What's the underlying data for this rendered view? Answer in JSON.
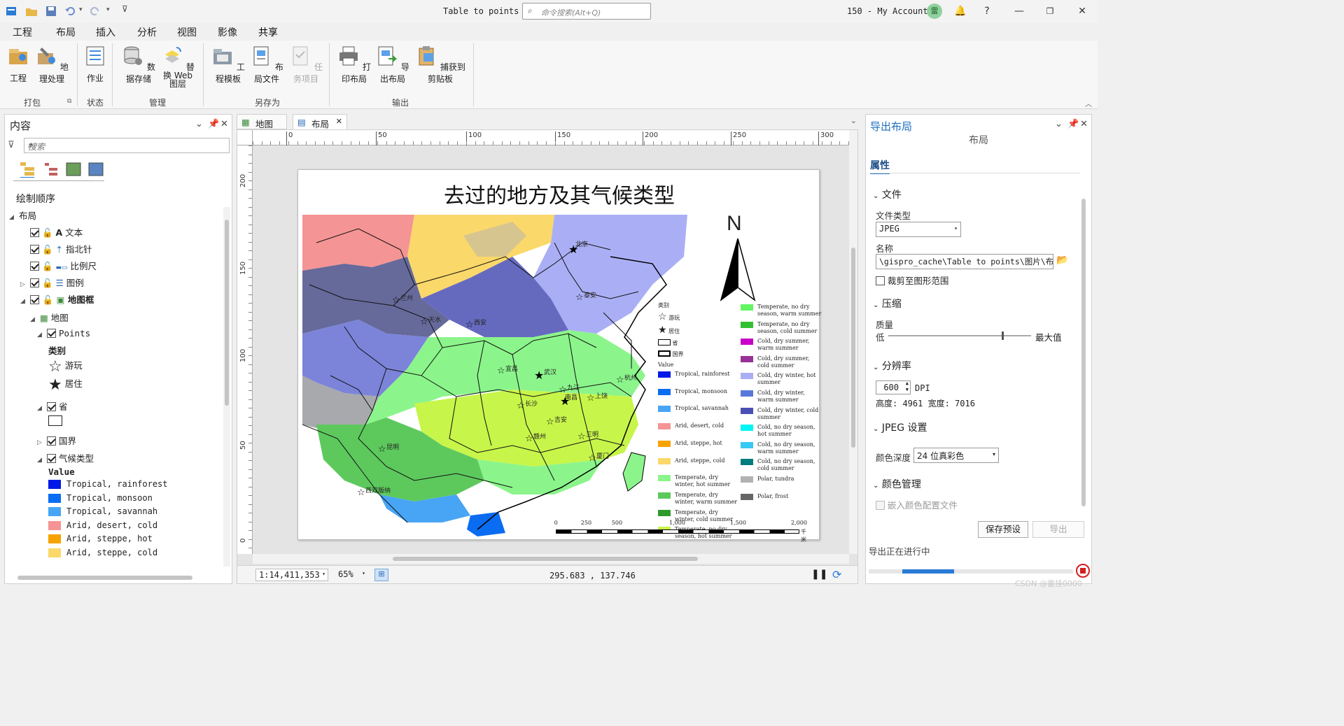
{
  "titlebar": {
    "title": "Table to points",
    "search_placeholder": "命令搜索(Alt+Q)",
    "account": "150 - My Account",
    "avatar_text": "雷"
  },
  "ribbon": {
    "tabs": [
      "工程",
      "布局",
      "插入",
      "分析",
      "视图",
      "影像",
      "共享"
    ],
    "active_tab": "共享",
    "buttons": {
      "project": "工程",
      "geoprocessing": "地理处理",
      "job": "作业",
      "data_store": "数据存储",
      "replace_web_1": "替换 Web",
      "replace_web_2": "图层",
      "project_template": "工程模板",
      "layout_file": "布局文件",
      "task_item": "任务项目",
      "print_layout": "打印布局",
      "export_layout": "导出布局",
      "capture_clipboard": "捕获到剪贴板"
    },
    "groups": {
      "package": "打包",
      "status": "状态",
      "manage": "管理",
      "save_as": "另存为",
      "output": "输出"
    }
  },
  "contents": {
    "title": "内容",
    "search_placeholder": "搜索",
    "drawing_order": "绘制顺序",
    "layout": "布局",
    "text": "文本",
    "north_arrow": "指北针",
    "scale_bar": "比例尺",
    "legend": "图例",
    "map_frame": "地图框",
    "map": "地图",
    "points": "Points",
    "category": "类别",
    "visited": "游玩",
    "lived": "居住",
    "province": "省",
    "border": "国界",
    "climate": "气候类型",
    "value_header": "Value",
    "legend_items": [
      {
        "label": "Tropical, rainforest",
        "color": "#0019e6"
      },
      {
        "label": "Tropical, monsoon",
        "color": "#0a6cf0"
      },
      {
        "label": "Tropical, savannah",
        "color": "#48a5f5"
      },
      {
        "label": "Arid, desert, cold",
        "color": "#f59494"
      },
      {
        "label": "Arid, steppe, hot",
        "color": "#f5a300"
      },
      {
        "label": "Arid, steppe, cold",
        "color": "#fbd86a"
      }
    ]
  },
  "view": {
    "tab_map": "地图",
    "tab_layout": "布局",
    "hruler_ticks": [
      "0",
      "50",
      "100",
      "150",
      "200",
      "250",
      "300"
    ],
    "vruler_ticks": [
      "200",
      "150",
      "100",
      "50",
      "0"
    ],
    "scale": "1:14,411,353",
    "zoom": "65%",
    "coords": "295.683 , 137.746"
  },
  "map": {
    "title": "去过的地方及其气候类型",
    "north": "N",
    "legend_category_title": "类别",
    "legend_visited": "游玩",
    "legend_lived": "居住",
    "legend_province": "省",
    "legend_border": "国界",
    "legend_value_title": "Value",
    "legend_col1": [
      {
        "label": "Tropical, rainforest",
        "color": "#0019e6"
      },
      {
        "label": "Tropical, monsoon",
        "color": "#0a6cf0"
      },
      {
        "label": "Tropical, savannah",
        "color": "#48a5f5"
      },
      {
        "label": "Arid, desert, cold",
        "color": "#f59494"
      },
      {
        "label": "Arid, steppe, hot",
        "color": "#f5a300"
      },
      {
        "label": "Arid, steppe, cold",
        "color": "#fbd86a"
      },
      {
        "label": "Temperate, dry winter, hot summer",
        "color": "#8bf58b"
      },
      {
        "label": "Temperate, dry winter, warm summer",
        "color": "#5dc95d"
      },
      {
        "label": "Temperate, dry winter, cold summer",
        "color": "#2e9a2e"
      },
      {
        "label": "Temperate, no dry season, hot summer",
        "color": "#c8f54a"
      }
    ],
    "legend_col2": [
      {
        "label": "Temperate, no dry season, warm summer",
        "color": "#63f563"
      },
      {
        "label": "Temperate, no dry season, cold summer",
        "color": "#32c032"
      },
      {
        "label": "Cold, dry summer, warm summer",
        "color": "#c800c8"
      },
      {
        "label": "Cold, dry summer, cold summer",
        "color": "#963296"
      },
      {
        "label": "Cold, dry winter, hot summer",
        "color": "#aaaff5"
      },
      {
        "label": "Cold, dry winter, warm summer",
        "color": "#5a78dc"
      },
      {
        "label": "Cold, dry winter, cold summer",
        "color": "#4b50b4"
      },
      {
        "label": "Cold, no dry season, hot summer",
        "color": "#00f5f5"
      },
      {
        "label": "Cold, no dry season, warm summer",
        "color": "#37c8f5"
      },
      {
        "label": "Cold, no dry season, cold summer",
        "color": "#007d7d"
      },
      {
        "label": "Polar, tundra",
        "color": "#b2b2b2"
      },
      {
        "label": "Polar, frost",
        "color": "#666666"
      }
    ],
    "scale_ticks": [
      "0",
      "250",
      "500",
      "1,000",
      "1,500",
      "2,000"
    ],
    "scale_unit": "千米",
    "cities": [
      "北京",
      "泰安",
      "兰州",
      "天水",
      "西安",
      "宜昌",
      "武汉",
      "九江",
      "南昌",
      "上饶",
      "杭州",
      "长沙",
      "吉安",
      "赣州",
      "三明",
      "昆明",
      "西双版纳",
      "厦门"
    ]
  },
  "export": {
    "title": "导出布局",
    "subtitle": "布局",
    "properties": "属性",
    "file_section": "文件",
    "file_type_label": "文件类型",
    "file_type": "JPEG",
    "name_label": "名称",
    "name_value": "\\gispro_cache\\Table to points\\图片\\布局",
    "clip_label": "裁剪至图形范围",
    "compress_section": "压缩",
    "quality_label": "质量",
    "quality_low": "低",
    "quality_high": "最大值",
    "resolution_section": "分辨率",
    "dpi_value": "600",
    "dpi_unit": "DPI",
    "dims": "高度: 4961 宽度: 7016",
    "jpeg_section": "JPEG 设置",
    "color_depth_label": "颜色深度",
    "color_depth": "24 位真彩色",
    "color_mgmt_section": "颜色管理",
    "embed_profile": "嵌入颜色配置文件",
    "save_preset": "保存预设",
    "export_btn": "导出",
    "progress_text": "导出正在进行中",
    "quality_fraction": 0.8
  },
  "watermark": "CSDN @雷挂0000"
}
